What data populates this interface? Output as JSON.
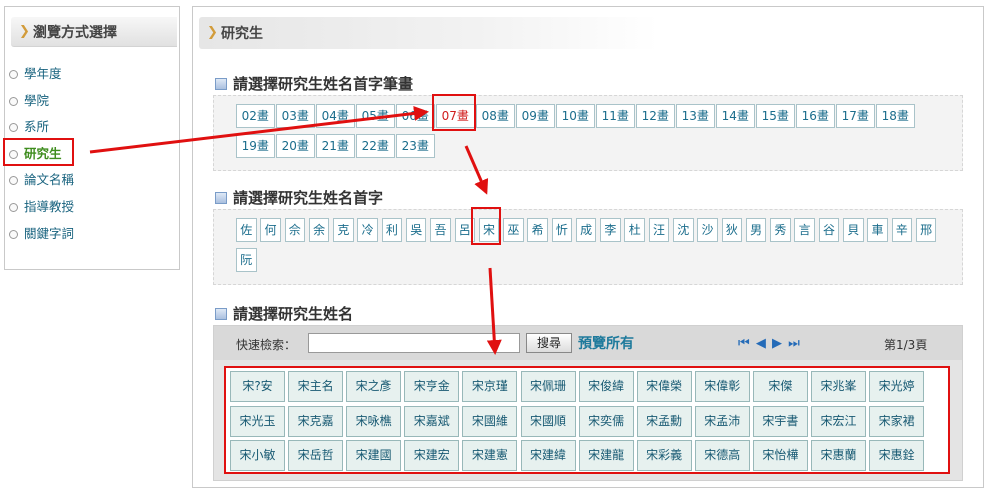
{
  "sidebar": {
    "title": "瀏覽方式選擇",
    "items": [
      "學年度",
      "學院",
      "系所",
      "研究生",
      "論文名稱",
      "指導教授",
      "關鍵字詞"
    ],
    "selected_index": 3
  },
  "main": {
    "title": "研究生",
    "stroke_section_title": "請選擇研究生姓名首字筆畫",
    "strokes": [
      "02畫",
      "03畫",
      "04畫",
      "05畫",
      "06畫",
      "07畫",
      "08畫",
      "09畫",
      "10畫",
      "11畫",
      "12畫",
      "13畫",
      "14畫",
      "15畫",
      "16畫",
      "17畫",
      "18畫",
      "19畫",
      "20畫",
      "21畫",
      "22畫",
      "23畫"
    ],
    "selected_stroke_index": 5,
    "char_section_title": "請選擇研究生姓名首字",
    "chars": [
      "佐",
      "何",
      "佘",
      "余",
      "克",
      "冷",
      "利",
      "吳",
      "吾",
      "呂",
      "宋",
      "巫",
      "希",
      "忻",
      "成",
      "李",
      "杜",
      "汪",
      "沈",
      "沙",
      "狄",
      "男",
      "秀",
      "言",
      "谷",
      "貝",
      "車",
      "辛",
      "邢",
      "阮"
    ],
    "selected_char_index": 10,
    "name_section_title": "請選擇研究生姓名",
    "quick_search_label": "快速檢索：",
    "quick_search_value": "",
    "search_button": "搜尋",
    "preview_all": "預覽所有",
    "page_info": "第1/3頁",
    "names": [
      "宋?安",
      "宋主名",
      "宋之彥",
      "宋亨金",
      "宋京瑾",
      "宋佩珊",
      "宋俊緯",
      "宋偉榮",
      "宋偉彰",
      "宋傑",
      "宋兆峯",
      "宋光婷",
      "宋光玉",
      "宋克嘉",
      "宋咏樵",
      "宋嘉斌",
      "宋國維",
      "宋國順",
      "宋奕儒",
      "宋孟勳",
      "宋孟沛",
      "宋宇書",
      "宋宏江",
      "宋家裙",
      "宋小敏",
      "宋岳哲",
      "宋建國",
      "宋建宏",
      "宋建憲",
      "宋建緯",
      "宋建龍",
      "宋彩義",
      "宋德高",
      "宋怡樺",
      "宋惠蘭",
      "宋惠銓"
    ]
  },
  "colors": {
    "highlight": "#e01010",
    "link": "#1b6d8c",
    "selected_menu": "#3f8d1e",
    "accent_chevron": "#d29c3b"
  }
}
